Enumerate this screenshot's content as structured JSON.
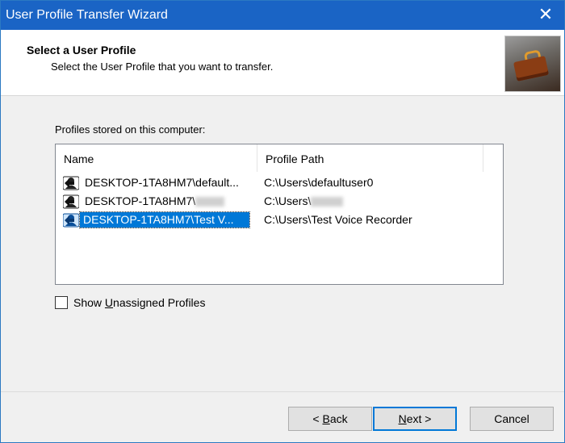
{
  "window": {
    "title": "User Profile Transfer Wizard",
    "close_glyph": "✕"
  },
  "header": {
    "title": "Select a User Profile",
    "subtitle": "Select the User Profile that you want to transfer.",
    "image_icon": "briefcase-icon"
  },
  "profiles": {
    "label": "Profiles stored on this computer:",
    "columns": [
      "Name",
      "Profile Path"
    ],
    "rows": [
      {
        "name": "DESKTOP-1TA8HM7\\default...",
        "path": "C:\\Users\\defaultuser0",
        "selected": false
      },
      {
        "name": "DESKTOP-1TA8HM7\\",
        "path": "C:\\Users\\",
        "selected": false,
        "redacted": true
      },
      {
        "name": "DESKTOP-1TA8HM7\\Test V...",
        "path": "C:\\Users\\Test Voice Recorder",
        "selected": true
      }
    ],
    "row_icon": "user-profile-icon"
  },
  "options": {
    "show_unassigned_prefix": "Show ",
    "show_unassigned_accel": "U",
    "show_unassigned_rest": "nassigned Profiles",
    "checked": false
  },
  "buttons": {
    "back_prefix": "< ",
    "back_accel": "B",
    "back_rest": "ack",
    "next_accel": "N",
    "next_rest": "ext >",
    "cancel": "Cancel"
  },
  "colors": {
    "titlebar": "#1a64c5",
    "selection": "#0078d7"
  }
}
